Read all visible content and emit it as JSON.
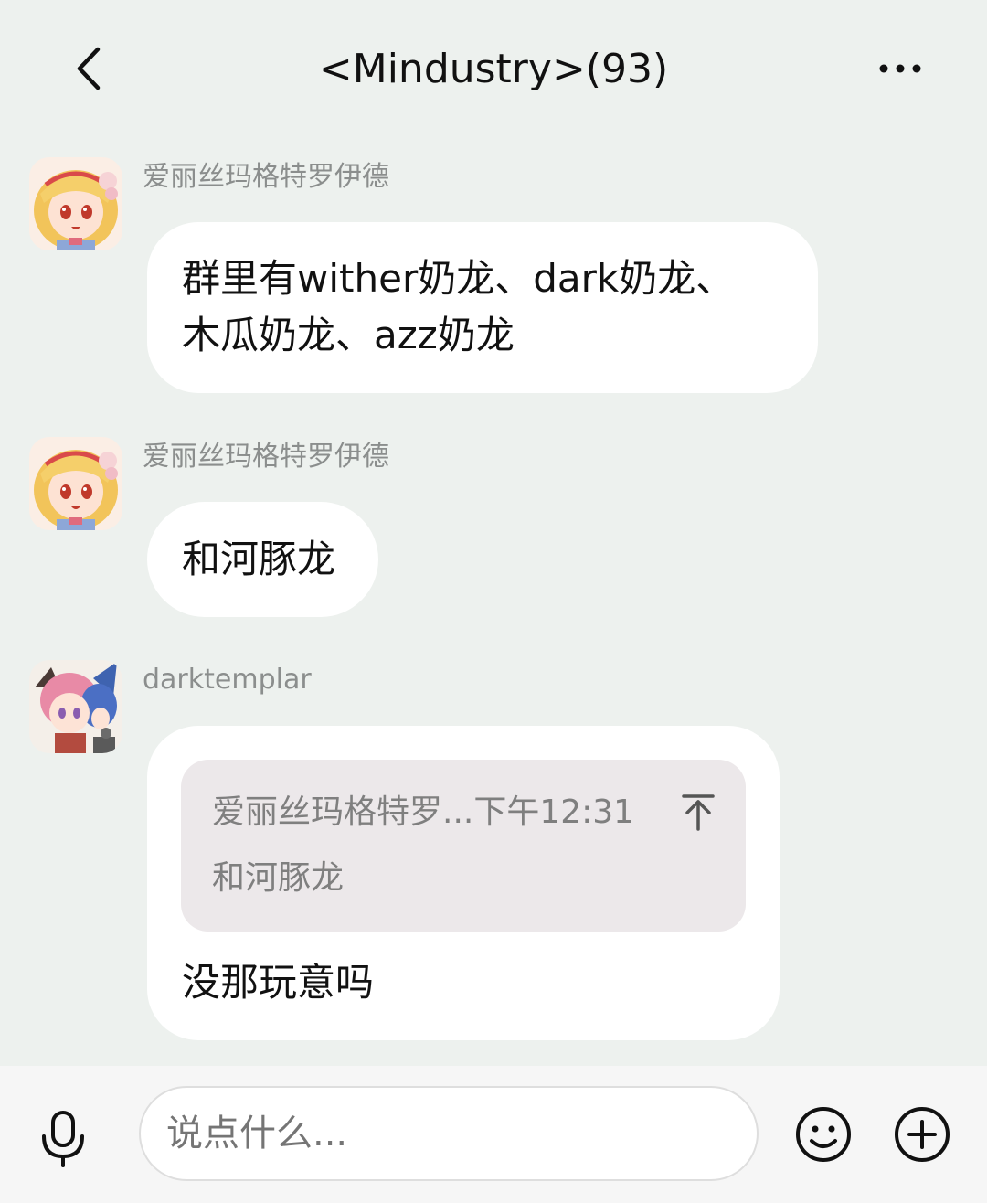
{
  "header": {
    "title": "<Mindustry>(93)",
    "back_icon": "chevron-left-icon",
    "more_icon": "more-dots-icon"
  },
  "messages": [
    {
      "sender": "爱丽丝玛格特罗伊德",
      "avatar": "avatar-alice",
      "lines": [
        "群里有wither奶龙、dark奶龙、",
        "木瓜奶龙、azz奶龙"
      ]
    },
    {
      "sender": "爱丽丝玛格特罗伊德",
      "avatar": "avatar-alice",
      "text": "和河豚龙"
    },
    {
      "sender": "darktemplar",
      "avatar": "avatar-darktemplar",
      "quote": {
        "header": "爱丽丝玛格特罗...下午12:31",
        "body": "和河豚龙",
        "jump_icon": "jump-to-top-icon"
      },
      "text": "没那玩意吗"
    }
  ],
  "input": {
    "placeholder": "说点什么...",
    "mic_icon": "microphone-icon",
    "emoji_icon": "emoji-icon",
    "plus_icon": "plus-circle-icon"
  },
  "colors": {
    "background": "#edf1ee",
    "bubble": "#ffffff",
    "quote_bg": "#ece8ea",
    "sender_text": "#8b8e8d"
  }
}
